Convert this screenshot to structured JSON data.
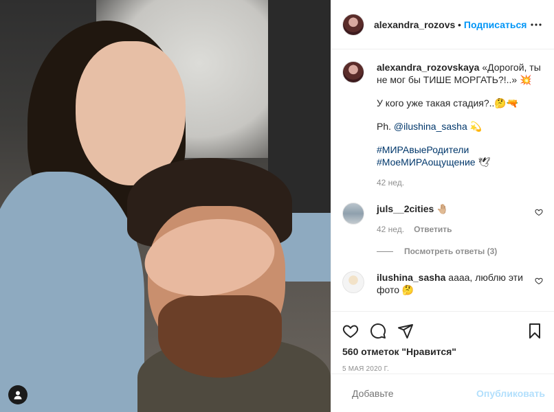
{
  "post": {
    "username": "alexandra_rozovskaya",
    "follow_label": "Подписаться",
    "header_dot": "•"
  },
  "caption": {
    "username": "alexandra_rozovskaya",
    "line1": "«Дорогой, ты не мог бы ТИШЕ МОРГАТЬ?!..» 💥",
    "line2": "У кого уже такая стадия?..🤔🔫",
    "photo_prefix": "Ph. ",
    "photo_credit": "@ilushina_sasha",
    "photo_suffix": " 💫",
    "hashtag1": "#МИРАвыеРодители",
    "hashtag2": "#МоеМИРАощущение",
    "hashtag2_suffix": " 🕊",
    "time": "42 нед."
  },
  "comments": [
    {
      "username": "juls__2cities",
      "text": "🤚🏼",
      "time": "42 нед.",
      "reply_label": "Ответить",
      "view_replies": "Посмотреть ответы (3)"
    },
    {
      "username": "ilushina_sasha",
      "text": "аааа, люблю эти фото 🤔"
    }
  ],
  "actions": {
    "likes": "560 отметок \"Нравится\"",
    "date": "5 мая 2020 г."
  },
  "composer": {
    "placeholder": "Добавьте",
    "publish_label": "Опубликовать"
  }
}
